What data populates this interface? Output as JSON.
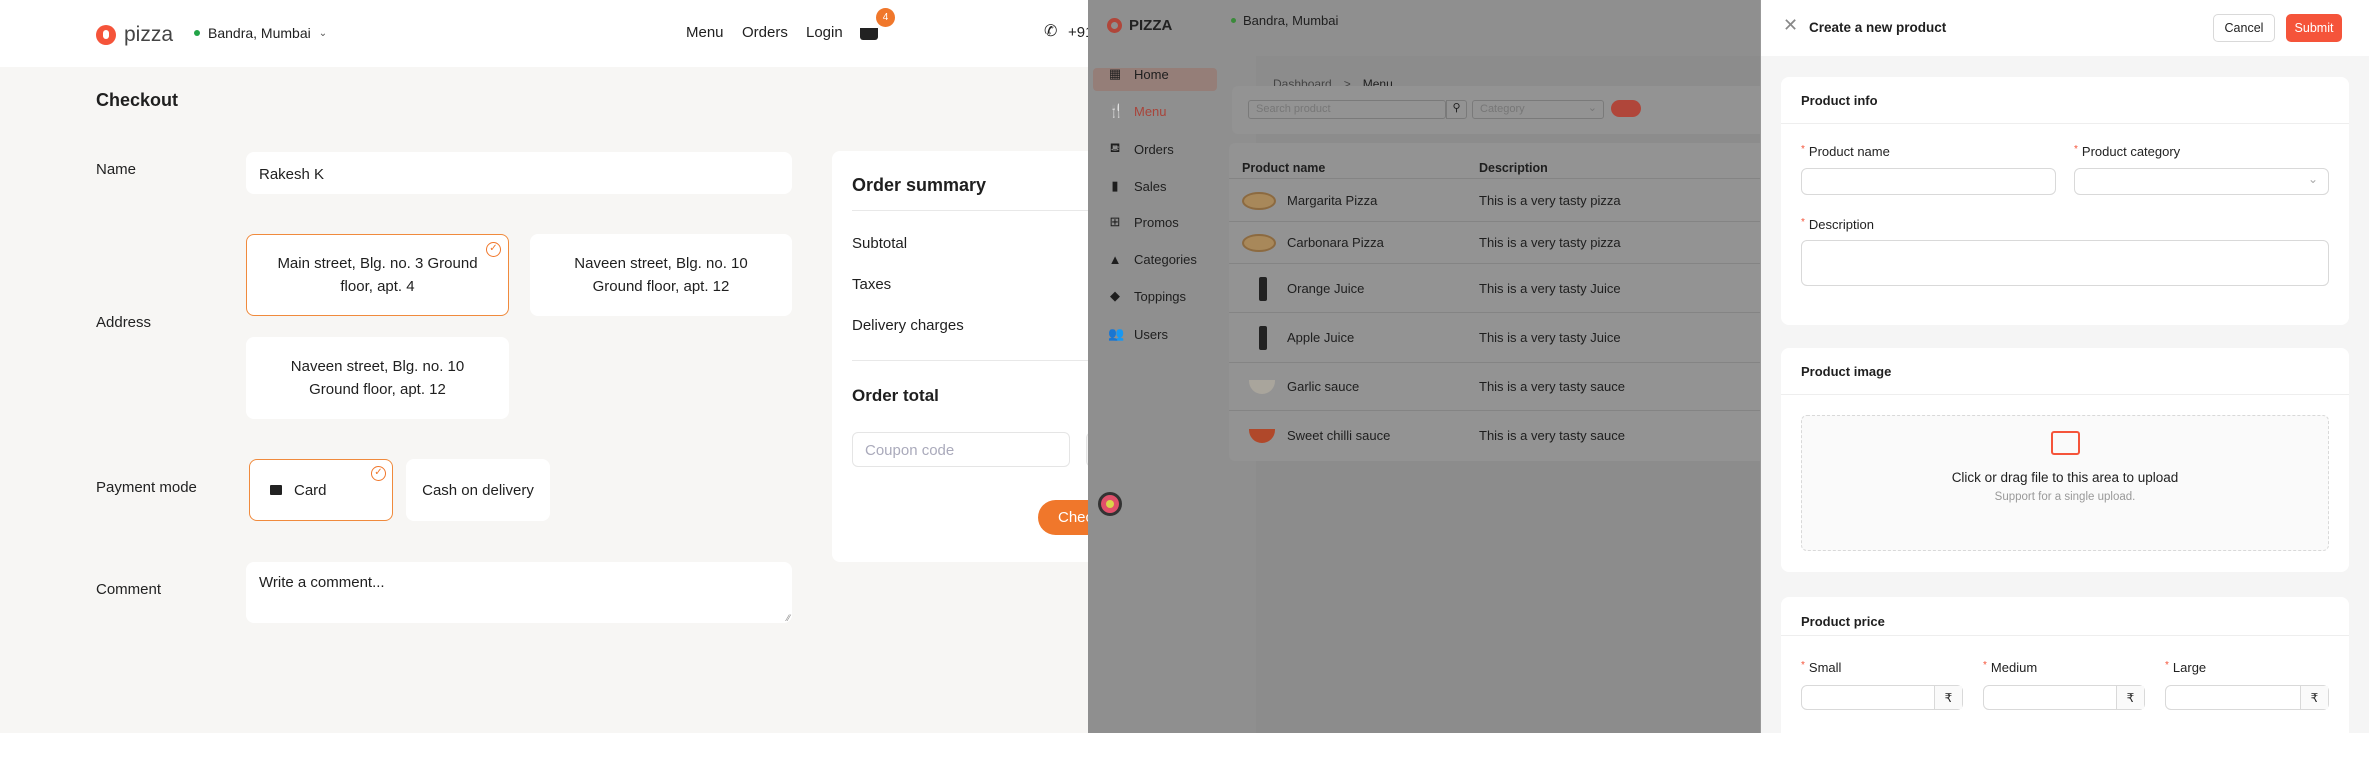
{
  "checkout": {
    "header": {
      "logo": "pizza",
      "location": "Bandra, Mumbai",
      "nav": [
        "Menu",
        "Orders",
        "Login"
      ],
      "cart_count": "4",
      "phone": "+91"
    },
    "title": "Checkout",
    "name_label": "Name",
    "name_value": "Rakesh K",
    "address_label": "Address",
    "addresses": [
      "Main street, Blg. no. 3 Ground floor, apt. 4",
      "Naveen street, Blg. no. 10 Ground floor, apt. 12",
      "Naveen street, Blg. no. 10 Ground floor, apt. 12"
    ],
    "payment_label": "Payment mode",
    "payment_options": [
      "Card",
      "Cash on delivery"
    ],
    "comment_label": "Comment",
    "comment_placeholder": "Write a comment...",
    "summary": {
      "title": "Order summary",
      "rows": [
        "Subtotal",
        "Taxes",
        "Delivery charges"
      ],
      "total_label": "Order total",
      "coupon_placeholder": "Coupon code",
      "checkout_button": "Chec"
    }
  },
  "admin": {
    "logo": "PIZZA",
    "location": "Bandra, Mumbai",
    "sidebar": [
      {
        "label": "Home",
        "icon": "grid-icon"
      },
      {
        "label": "Menu",
        "icon": "utensils-icon"
      },
      {
        "label": "Orders",
        "icon": "basket-icon"
      },
      {
        "label": "Sales",
        "icon": "bar-chart-icon"
      },
      {
        "label": "Promos",
        "icon": "gift-icon"
      },
      {
        "label": "Categories",
        "icon": "shapes-icon"
      },
      {
        "label": "Toppings",
        "icon": "layers-icon"
      },
      {
        "label": "Users",
        "icon": "users-icon"
      }
    ],
    "active": "Menu",
    "breadcrumb": [
      "Dashboard",
      "Menu"
    ],
    "search_placeholder": "Search product",
    "category_placeholder": "Category",
    "columns": [
      "Product name",
      "Description"
    ],
    "rows": [
      {
        "name": "Margarita Pizza",
        "description": "This is a very tasty pizza",
        "kind": "pizza"
      },
      {
        "name": "Carbonara Pizza",
        "description": "This is a very tasty pizza",
        "kind": "pizza"
      },
      {
        "name": "Orange Juice",
        "description": "This is a very tasty Juice",
        "kind": "juice"
      },
      {
        "name": "Apple Juice",
        "description": "This is a very tasty Juice",
        "kind": "juice"
      },
      {
        "name": "Garlic sauce",
        "description": "This is a very tasty sauce",
        "kind": "sauce-white"
      },
      {
        "name": "Sweet chilli sauce",
        "description": "This is a very tasty sauce",
        "kind": "sauce-red"
      }
    ]
  },
  "drawer": {
    "title": "Create a new product",
    "cancel": "Cancel",
    "submit": "Submit",
    "info": {
      "title": "Product info",
      "name_label": "Product name",
      "category_label": "Product category",
      "description_label": "Description"
    },
    "image": {
      "title": "Product image",
      "upload_text": "Click or drag file to this area to upload",
      "upload_hint": "Support for a single upload."
    },
    "price": {
      "title": "Product price",
      "sizes": [
        "Small",
        "Medium",
        "Large"
      ],
      "currency": "₹"
    }
  },
  "colors": {
    "accent": "#f0772b",
    "brand_red": "#f5543a"
  }
}
